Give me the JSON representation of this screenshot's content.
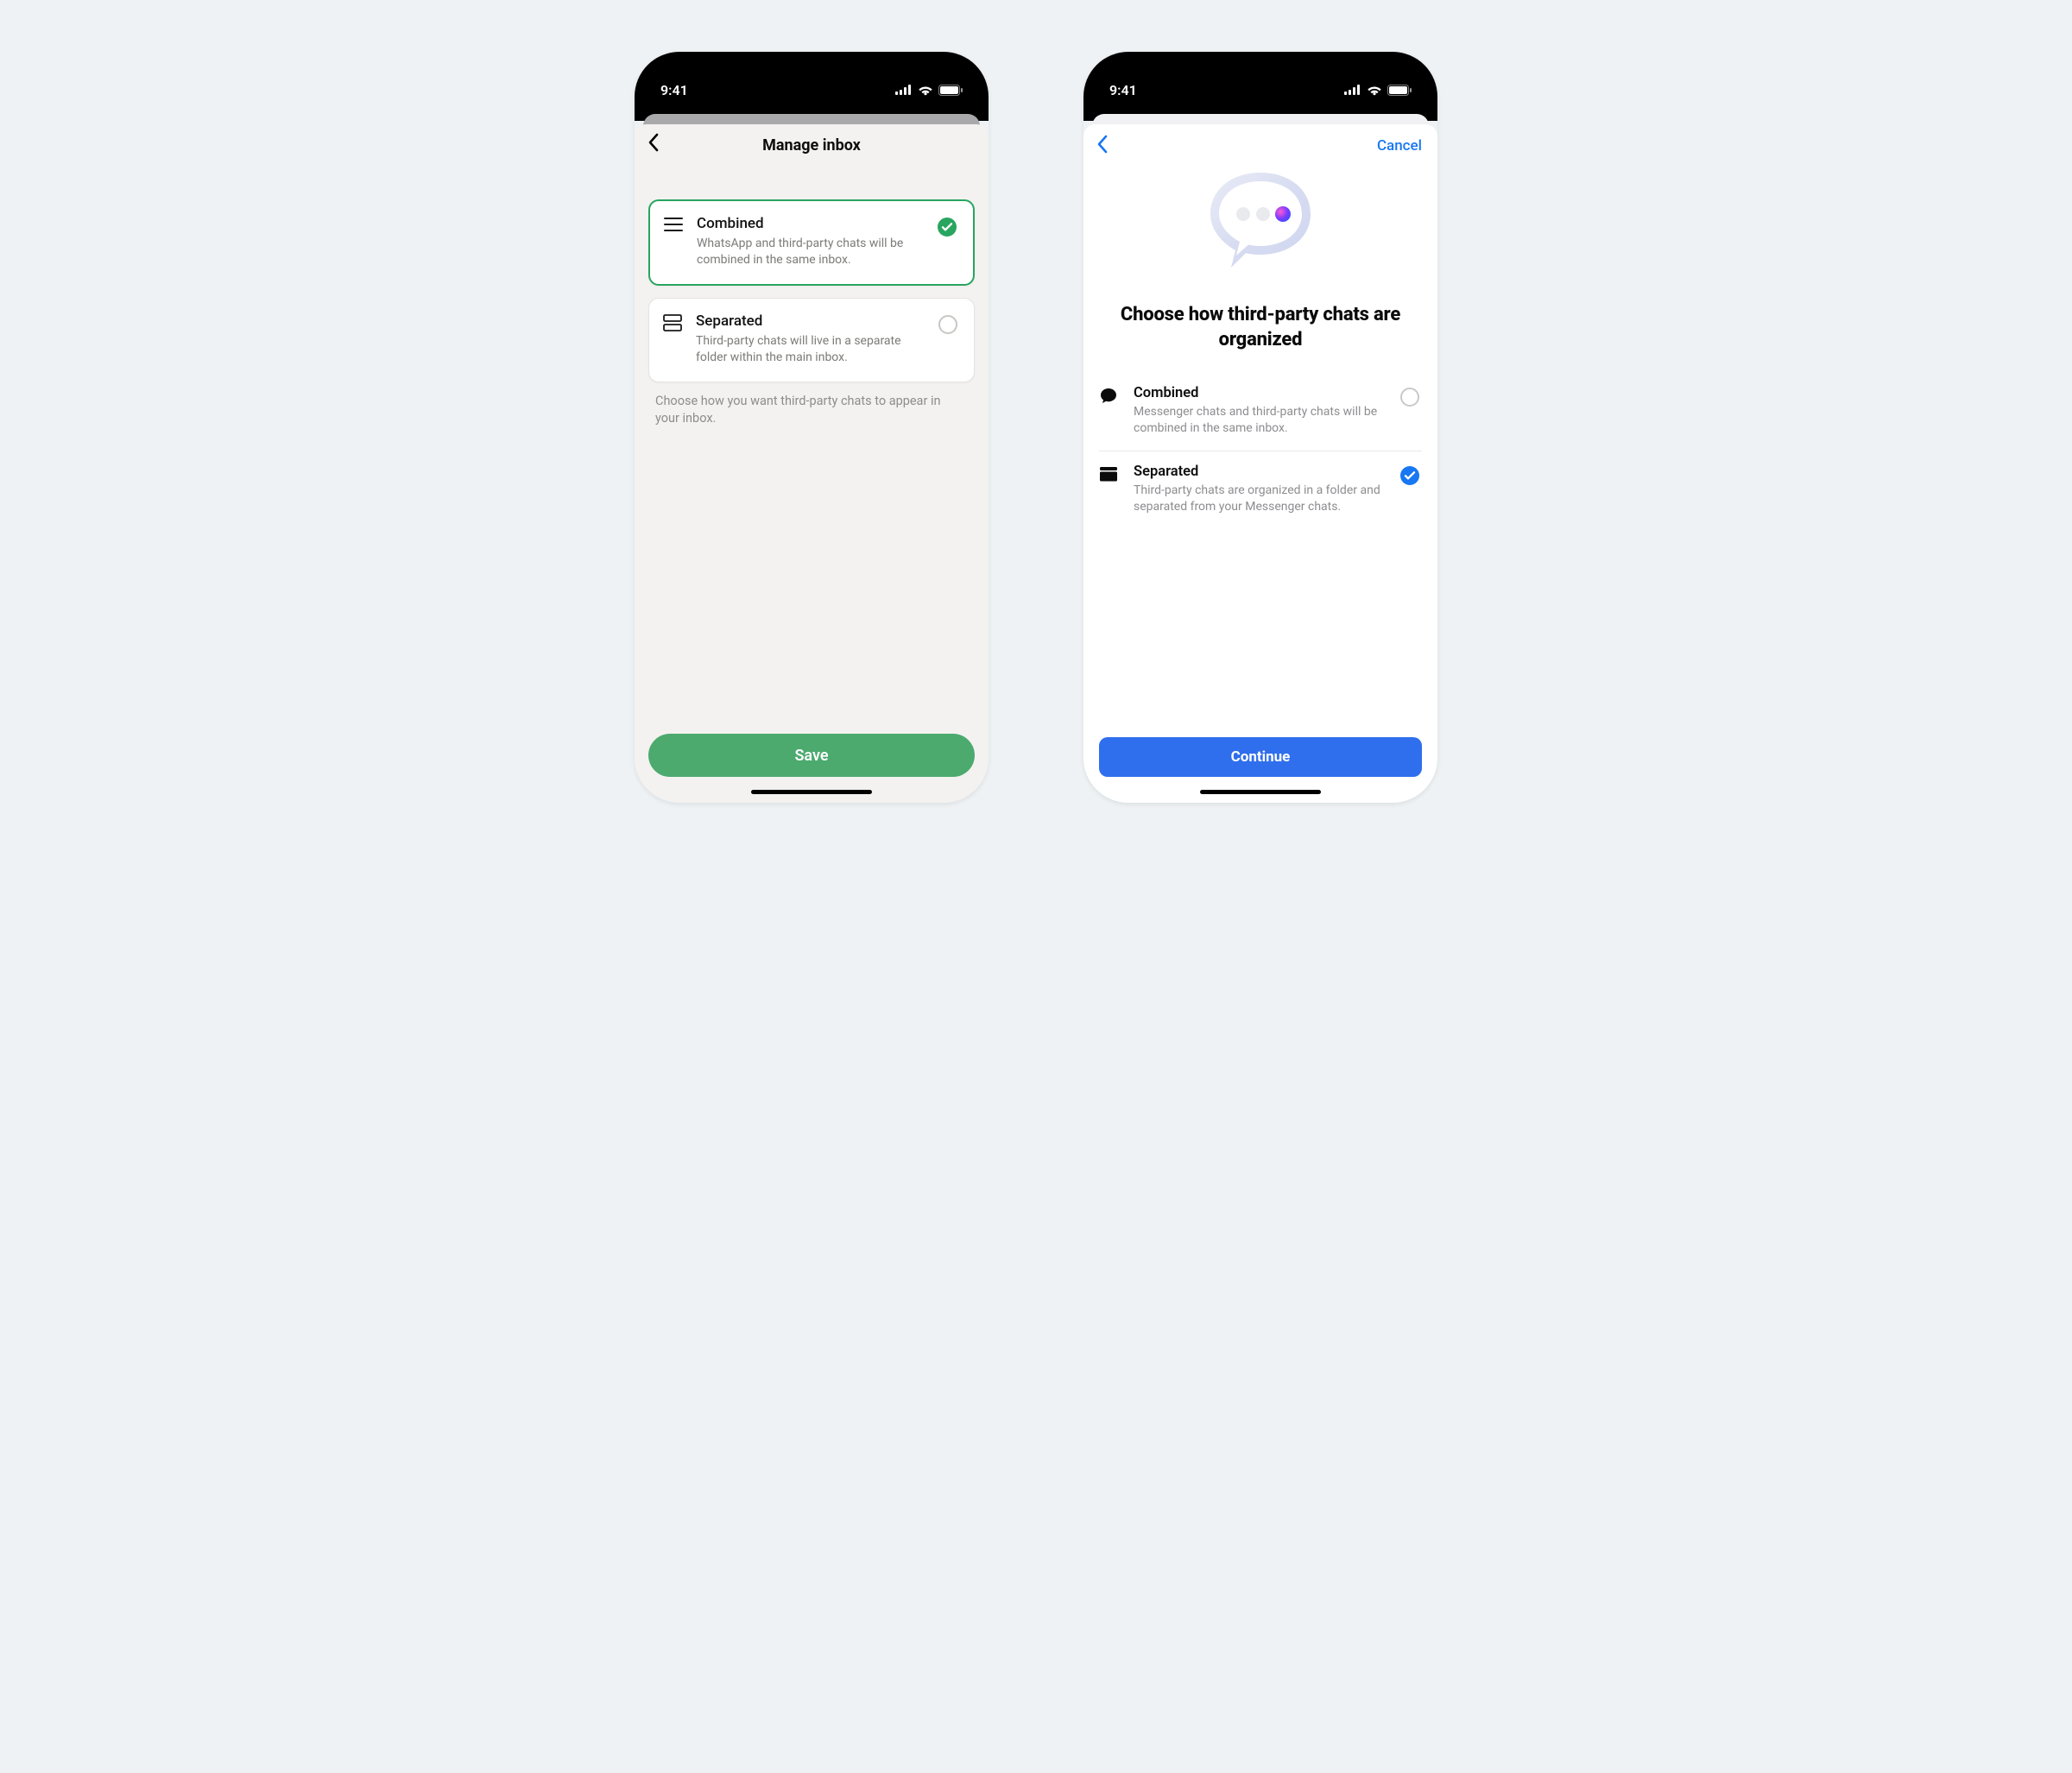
{
  "status_bar": {
    "time": "9:41"
  },
  "left": {
    "title": "Manage inbox",
    "options": [
      {
        "title": "Combined",
        "desc": "WhatsApp and third-party chats will be combined in the same inbox.",
        "selected": true
      },
      {
        "title": "Separated",
        "desc": "Third-party chats will live in a separate folder within the main inbox.",
        "selected": false
      }
    ],
    "helper": "Choose how you want third-party chats to appear in your inbox.",
    "save_label": "Save",
    "colors": {
      "accent": "#28a55f",
      "save_button": "#4caa6e"
    }
  },
  "right": {
    "cancel_label": "Cancel",
    "heading": "Choose how third-party chats are organized",
    "options": [
      {
        "title": "Combined",
        "desc": "Messenger chats and third-party chats will be combined in the same inbox.",
        "selected": false
      },
      {
        "title": "Separated",
        "desc": "Third-party chats are organized in a folder and separated from your Messenger chats.",
        "selected": true
      }
    ],
    "continue_label": "Continue",
    "colors": {
      "accent": "#1877f2",
      "continue_button": "#2f6fed"
    }
  }
}
